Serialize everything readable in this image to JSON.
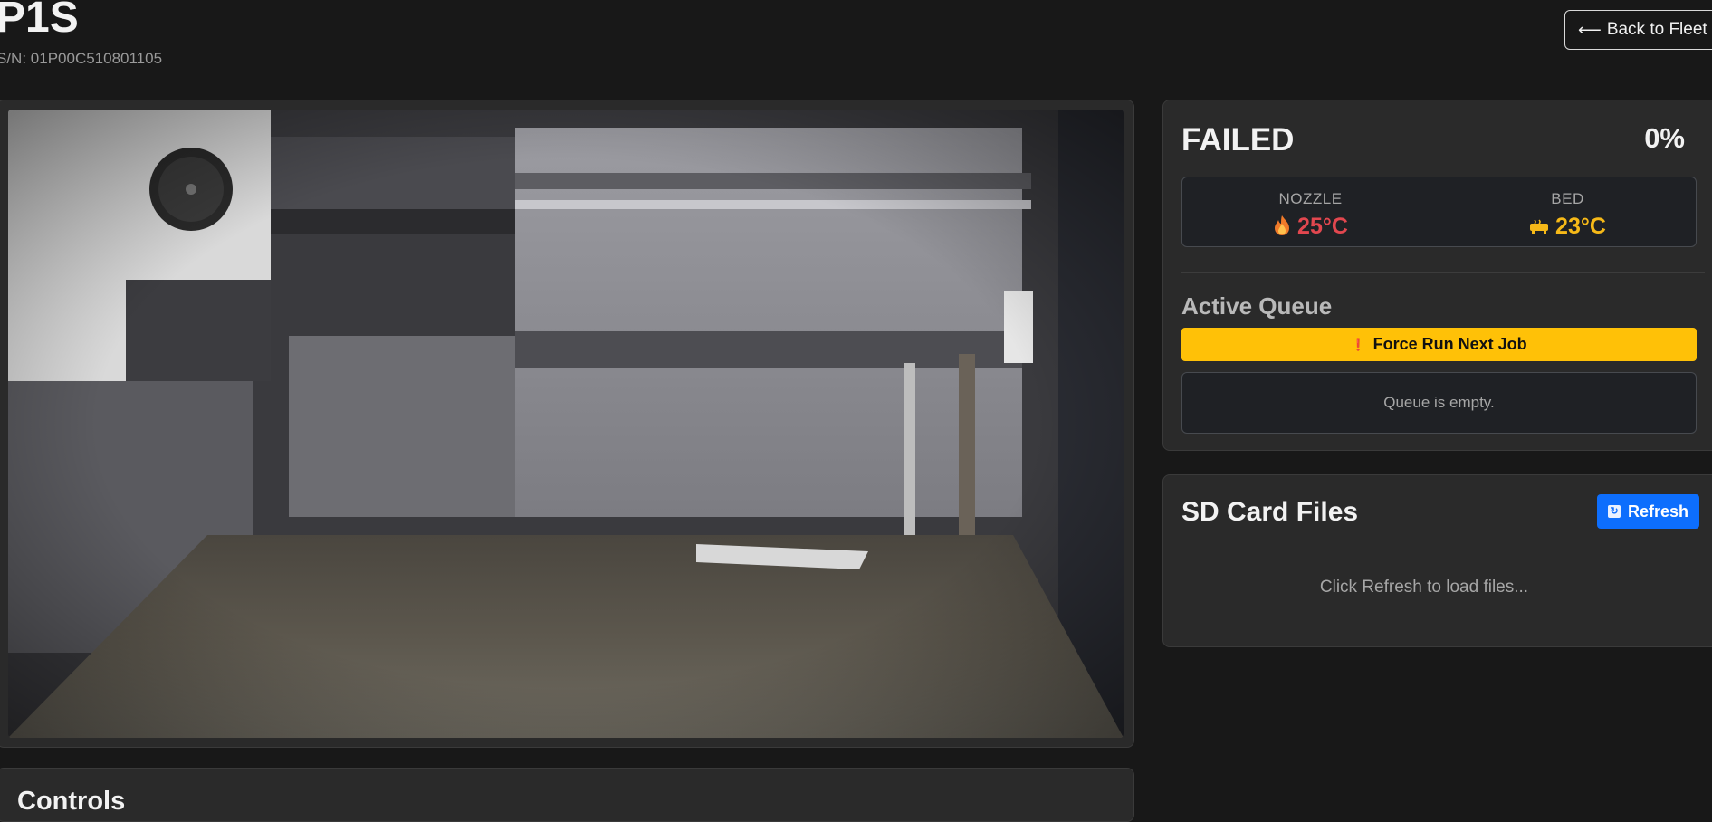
{
  "header": {
    "title": "P1S",
    "serial": "S/N: 01P00C510801105",
    "back_label": "Back to Fleet",
    "back_icon": "arrow-left-icon"
  },
  "camera": {
    "feed_icon": "camera-feed"
  },
  "controls": {
    "title": "Controls"
  },
  "status": {
    "label": "FAILED",
    "progress": "0%",
    "nozzle_label": "NOZZLE",
    "nozzle_temp": "25°C",
    "nozzle_icon": "flame-icon",
    "bed_label": "BED",
    "bed_temp": "23°C",
    "bed_icon": "heater-icon",
    "nozzle_color": "#e2474f",
    "bed_color": "#f6b918"
  },
  "queue": {
    "title": "Active Queue",
    "force_label": "Force Run Next Job",
    "force_icon": "warning-icon",
    "empty_text": "Queue is empty."
  },
  "sd": {
    "title": "SD Card Files",
    "refresh_label": "Refresh",
    "refresh_icon": "refresh-icon",
    "hint": "Click Refresh to load files..."
  },
  "colors": {
    "accent_blue": "#0d6efd",
    "warning_yellow": "#ffc107",
    "background": "#181818",
    "card": "#2a2a2a"
  }
}
